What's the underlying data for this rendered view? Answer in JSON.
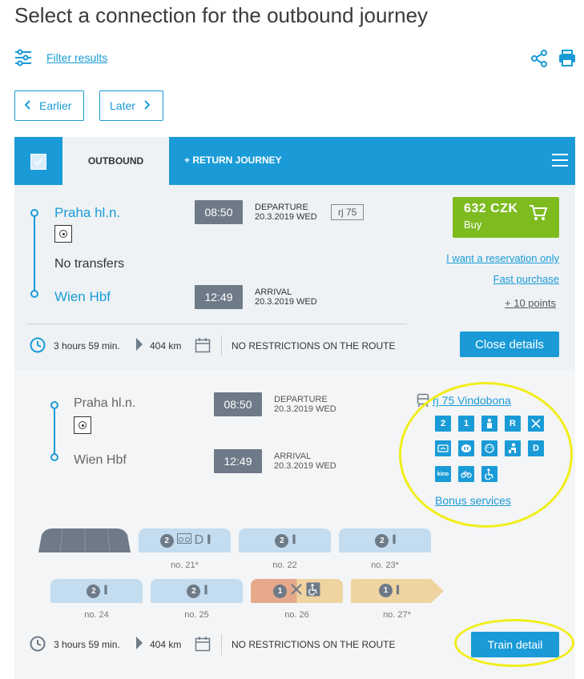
{
  "page_title": "Select a connection for the outbound journey",
  "filter": {
    "label": "Filter results"
  },
  "nav": {
    "earlier": "Earlier",
    "later": "Later"
  },
  "tabs": {
    "outbound": "OUTBOUND",
    "return": "+ RETURN JOURNEY"
  },
  "connection": {
    "from": "Praha hl.n.",
    "to": "Wien Hbf",
    "departure_time": "08:50",
    "departure_label": "DEPARTURE",
    "departure_date": "20.3.2019 WED",
    "arrival_time": "12:49",
    "arrival_label": "ARRIVAL",
    "arrival_date": "20.3.2019 WED",
    "train": "rj 75",
    "transfers": "No transfers",
    "price": "632 CZK",
    "buy_label": "Buy",
    "reservation_link": "I want a reservation only",
    "fast_purchase_link": "Fast purchase",
    "points_link": "+ 10 points",
    "duration": "3 hours 59 min.",
    "distance": "404 km",
    "restrictions": "NO RESTRICTIONS ON THE ROUTE",
    "close_details": "Close details"
  },
  "detail": {
    "from": "Praha hl.n.",
    "to": "Wien Hbf",
    "departure_time": "08:50",
    "departure_label": "DEPARTURE",
    "departure_date": "20.3.2019 WED",
    "arrival_time": "12:49",
    "arrival_label": "ARRIVAL",
    "arrival_date": "20.3.2019 WED",
    "train_link": "rj 75 Vindobona",
    "amenities_row1": [
      "2",
      "1",
      "person",
      "R",
      "restaurant"
    ],
    "amenities_row2": [
      "wifi",
      "power",
      "face",
      "quiet",
      "D"
    ],
    "amenities_row3": [
      "kino",
      "bike",
      "wheelchair"
    ],
    "bonus_link": "Bonus services",
    "cars_row1": [
      {
        "label": "",
        "class": ""
      },
      {
        "label": "no. 21*",
        "class": "2",
        "extra": "D"
      },
      {
        "label": "no. 22",
        "class": "2"
      },
      {
        "label": "no. 23*",
        "class": "2"
      }
    ],
    "cars_row2": [
      {
        "label": "no. 24",
        "class": "2"
      },
      {
        "label": "no. 25",
        "class": "2"
      },
      {
        "label": "no. 26",
        "class": "1"
      },
      {
        "label": "no. 27*",
        "class": "1"
      }
    ],
    "duration": "3 hours 59 min.",
    "distance": "404 km",
    "restrictions": "NO RESTRICTIONS ON THE ROUTE",
    "train_detail": "Train detail"
  },
  "colors": {
    "accent": "#1a9bd7",
    "buy": "#7dbb1f",
    "highlight": "#f1ee1a"
  }
}
